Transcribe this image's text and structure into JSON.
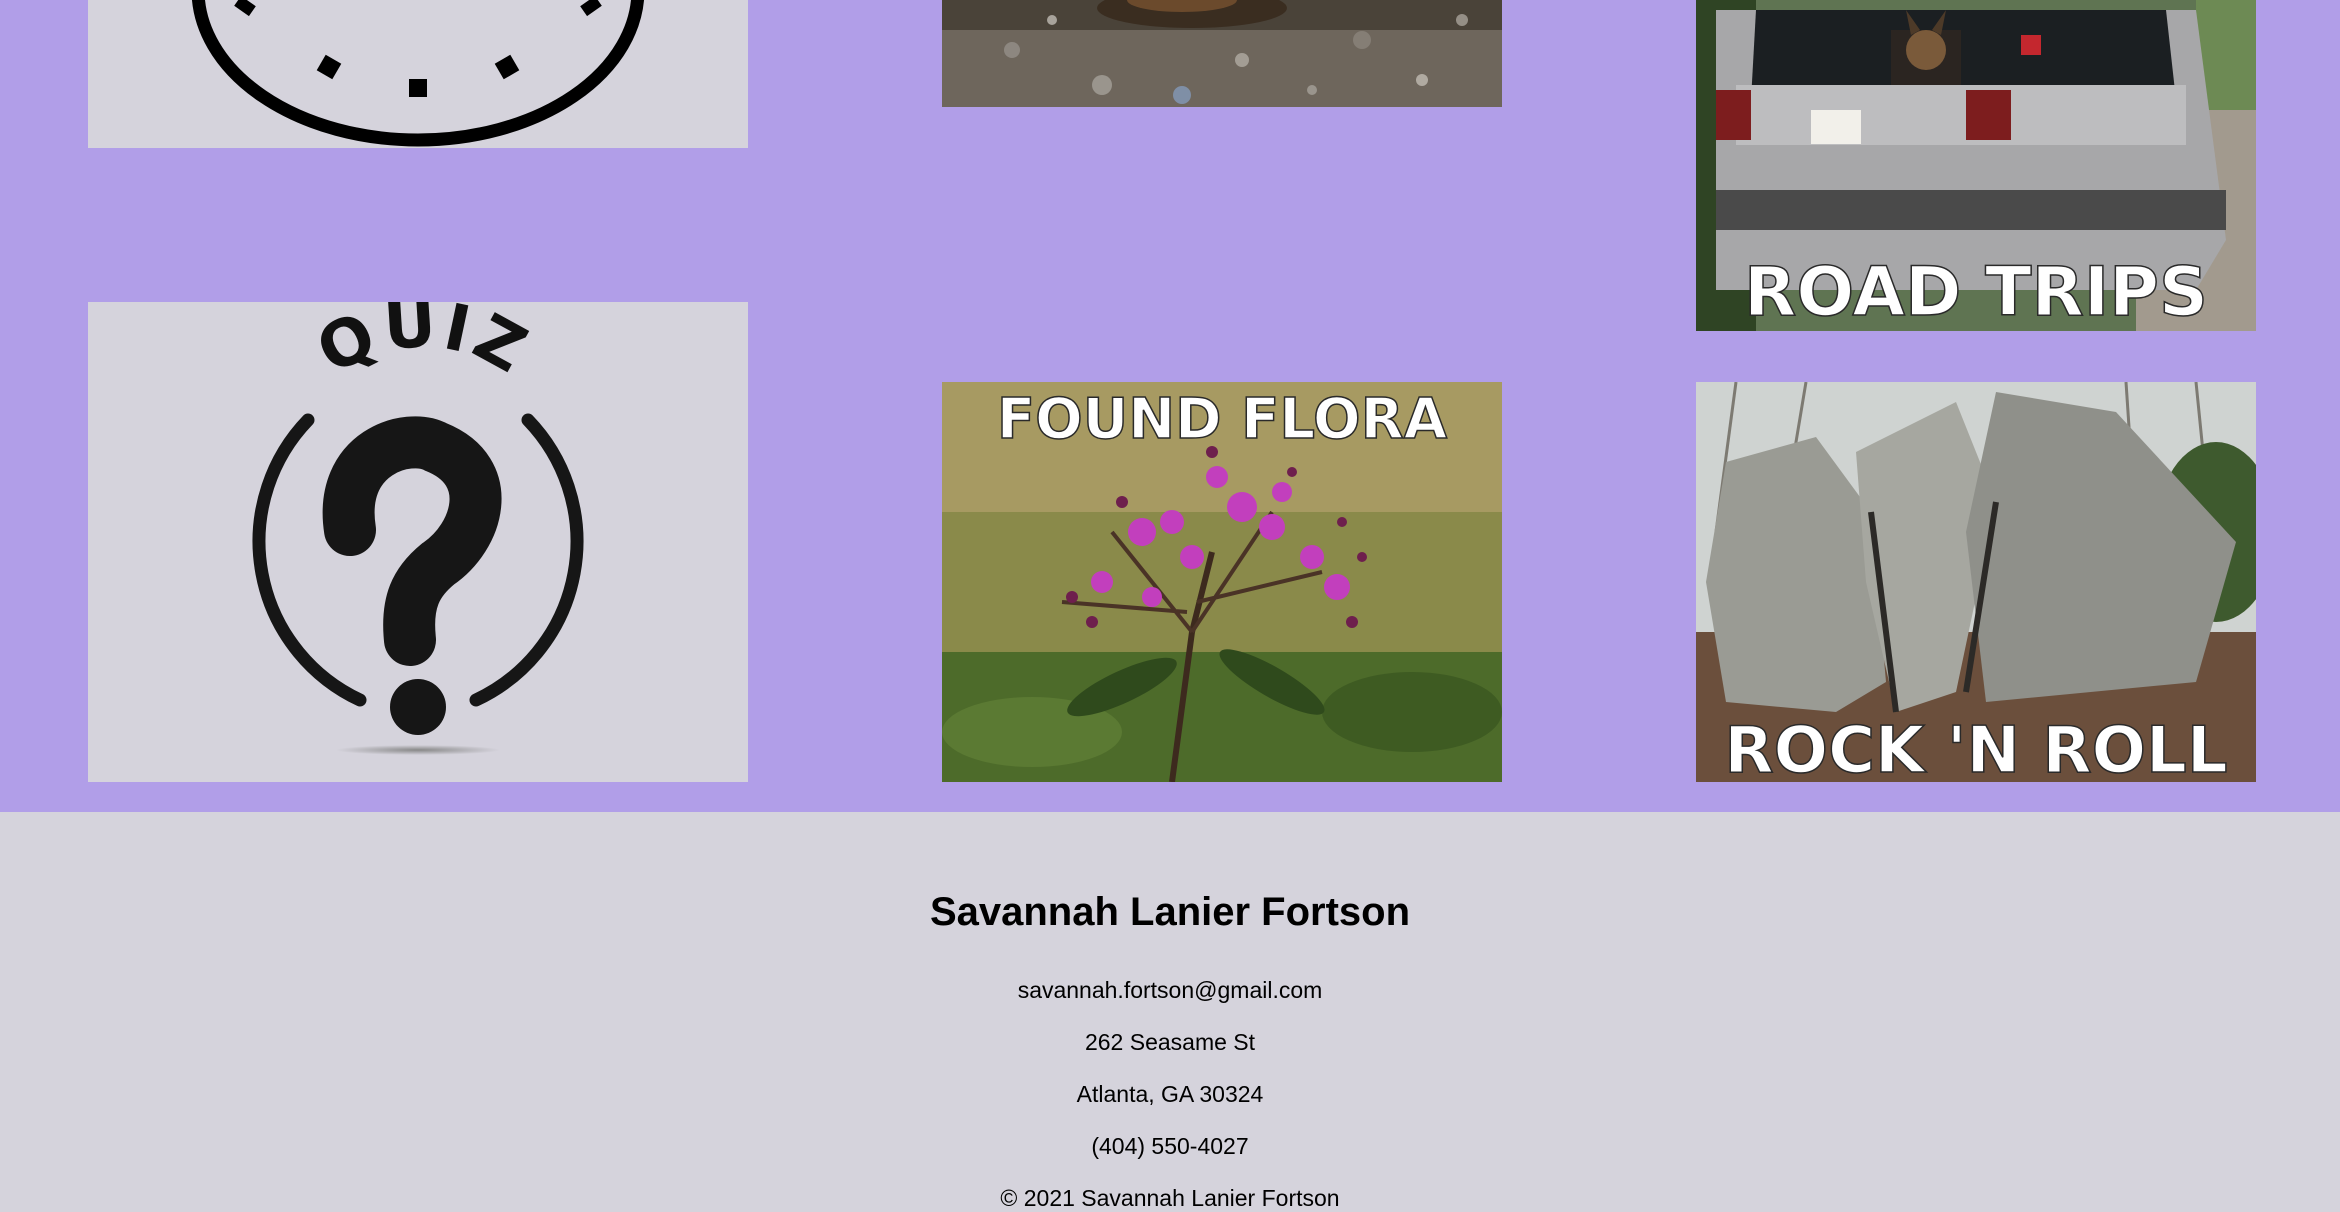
{
  "gallery": {
    "tiles": [
      {
        "id": "clock",
        "label": ""
      },
      {
        "id": "quiz",
        "label": "QUIZ"
      },
      {
        "id": "hike",
        "label": ""
      },
      {
        "id": "flora",
        "label": "FOUND FLORA"
      },
      {
        "id": "road",
        "label": "ROAD TRIPS"
      },
      {
        "id": "rock",
        "label": "ROCK 'N ROLL"
      }
    ],
    "background_color": "#b19ee8",
    "tile_bg_color": "#d5d3dc"
  },
  "footer": {
    "name": "Savannah Lanier Fortson",
    "email": "savannah.fortson@gmail.com",
    "street": "262 Seasame St",
    "city": "Atlanta, GA 30324",
    "phone": "(404) 550-4027",
    "copyright": "© 2021 Savannah Lanier Fortson",
    "background_color": "#d5d3dc"
  }
}
